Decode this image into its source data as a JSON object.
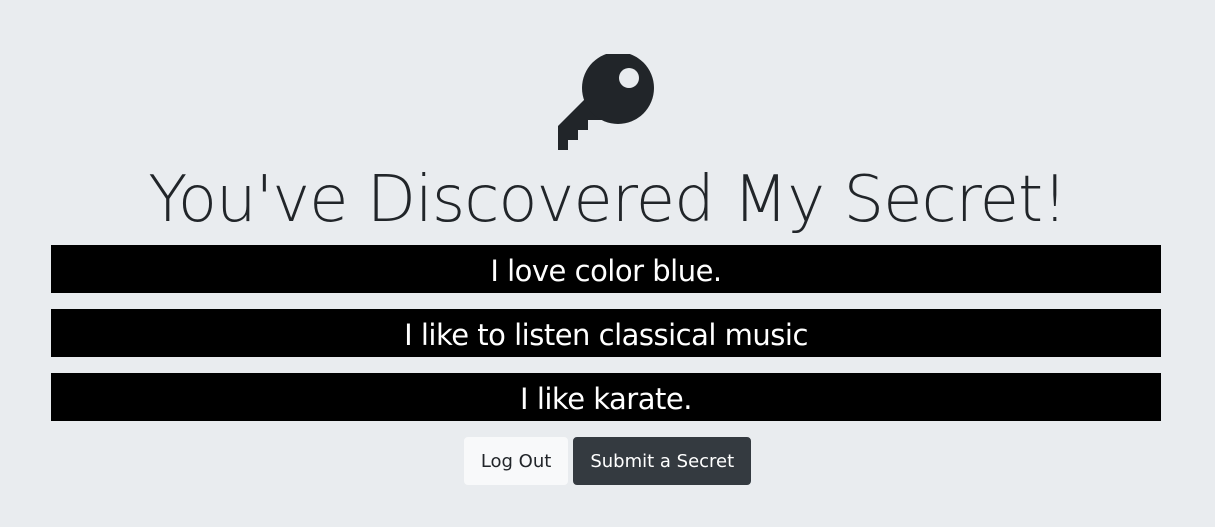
{
  "header": {
    "icon": "key-icon",
    "title": "You've Discovered My Secret!"
  },
  "secrets": [
    "I love color blue.",
    "I like to listen classical music",
    "I like karate."
  ],
  "actions": {
    "logout_label": "Log Out",
    "submit_label": "Submit a Secret"
  },
  "colors": {
    "background": "#e9ecef",
    "secret_bar": "#000000",
    "secret_text": "#ffffff",
    "light_button": "#f8f9fa",
    "dark_button": "#343a40",
    "text": "#212529"
  }
}
